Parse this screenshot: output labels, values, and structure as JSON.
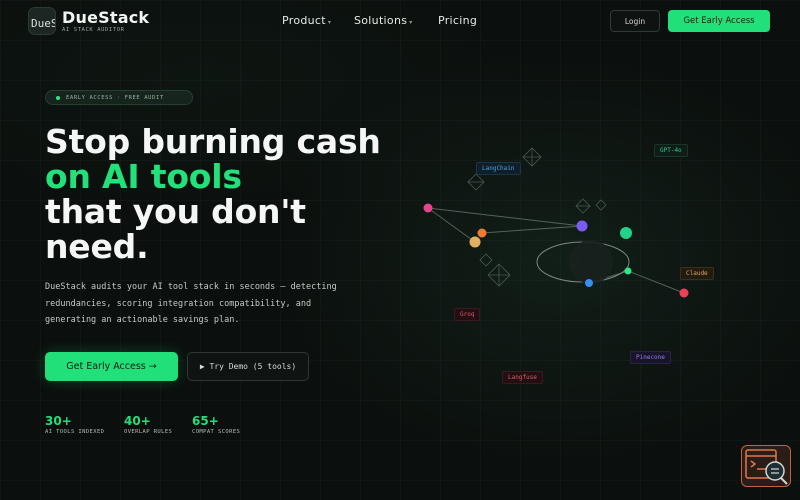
{
  "header": {
    "logo_text": "DueS",
    "brand": "DueStack",
    "tagline": "AI STACK AUDITOR",
    "nav": [
      {
        "label": "Product",
        "has_dropdown": true
      },
      {
        "label": "Solutions",
        "has_dropdown": true
      },
      {
        "label": "Pricing",
        "has_dropdown": false
      }
    ],
    "dropdown_glyph": "▾",
    "login_label": "Login",
    "cta_label": "Get Early Access"
  },
  "hero": {
    "badge": "EARLY ACCESS · FREE AUDIT",
    "title_line1": "Stop burning cash",
    "title_line2": "on AI tools",
    "title_line3": "that you don't",
    "title_line4": "need.",
    "description_line1": "DueStack audits your AI tool stack in seconds — detecting",
    "description_line2": "redundancies, scoring integration compatibility, and",
    "description_line3": "generating an actionable savings plan.",
    "primary_cta": "Get Early Access →",
    "secondary_cta": "▶ Try Demo (5 tools)"
  },
  "stats": [
    {
      "value": "30+",
      "label": "AI TOOLS INDEXED"
    },
    {
      "value": "40+",
      "label": "OVERLAP RULES"
    },
    {
      "value": "65+",
      "label": "COMPAT SCORES"
    }
  ],
  "graph": {
    "labels": [
      {
        "text": "LangChain",
        "color": "#4fa3e0"
      },
      {
        "text": "GPT-4o",
        "color": "#2ec98a"
      },
      {
        "text": "Claude",
        "color": "#e0a45a"
      },
      {
        "text": "Groq",
        "color": "#e05a6a"
      },
      {
        "text": "Pinecone",
        "color": "#9a7cf0"
      },
      {
        "text": "Langfuse",
        "color": "#e05a6a"
      }
    ]
  },
  "colors": {
    "accent": "#22e07a",
    "background": "#0b0f0d"
  }
}
